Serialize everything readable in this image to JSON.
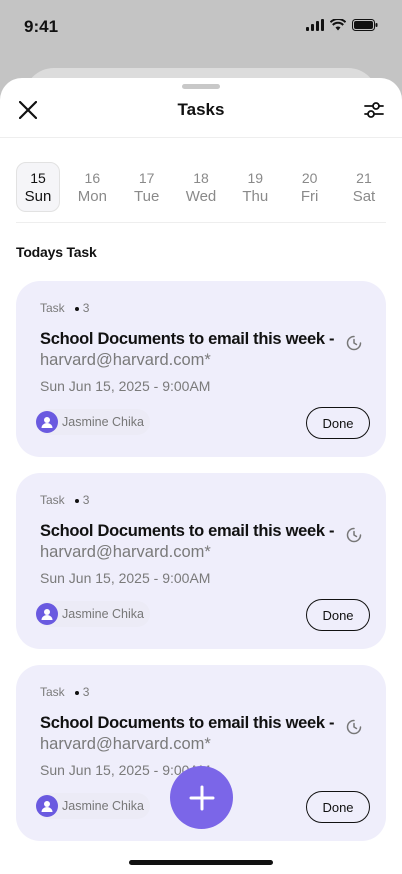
{
  "status_bar": {
    "time": "9:41"
  },
  "header": {
    "title": "Tasks",
    "close_icon": "close-icon",
    "filter_icon": "sliders-icon"
  },
  "week": [
    {
      "num": "15",
      "day": "Sun",
      "selected": true
    },
    {
      "num": "16",
      "day": "Mon",
      "selected": false
    },
    {
      "num": "17",
      "day": "Tue",
      "selected": false
    },
    {
      "num": "18",
      "day": "Wed",
      "selected": false
    },
    {
      "num": "19",
      "day": "Thu",
      "selected": false
    },
    {
      "num": "20",
      "day": "Fri",
      "selected": false
    },
    {
      "num": "21",
      "day": "Sat",
      "selected": false
    }
  ],
  "section_title": "Todays Task",
  "tasks": [
    {
      "label": "Task",
      "count": "3",
      "title": "School Documents to email this week -",
      "subtitle": "harvard@harvard.com*",
      "date": "Sun Jun 15, 2025 - 9:00AM",
      "assignee": "Jasmine Chika",
      "action": "Done"
    },
    {
      "label": "Task",
      "count": "3",
      "title": "School Documents to email this week -",
      "subtitle": "harvard@harvard.com*",
      "date": "Sun Jun 15, 2025 - 9:00AM",
      "assignee": "Jasmine Chika",
      "action": "Done"
    },
    {
      "label": "Task",
      "count": "3",
      "title": "School Documents to email this week -",
      "subtitle": "harvard@harvard.com*",
      "date": "Sun Jun 15, 2025 - 9:00AM",
      "assignee": "Jasmine Chika",
      "action": "Done"
    }
  ],
  "colors": {
    "accent": "#7b66e8",
    "card_bg": "#efeefb"
  },
  "fab": {
    "icon": "plus-icon"
  }
}
